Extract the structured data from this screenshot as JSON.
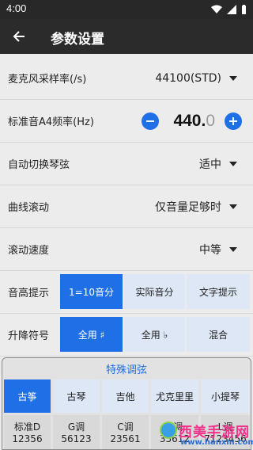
{
  "status_bar": {
    "time": "4:00"
  },
  "app_bar": {
    "title": "参数设置"
  },
  "settings": {
    "mic_sample_rate": {
      "label": "麦克风采样率(/s)",
      "value": "44100(STD)"
    },
    "a4_frequency": {
      "label": "标准音A4频率(Hz)",
      "value_int": "440.",
      "value_dec": "0"
    },
    "auto_switch": {
      "label": "自动切换琴弦",
      "value": "适中"
    },
    "curve_scroll": {
      "label": "曲线滚动",
      "value": "仅音量足够时"
    },
    "scroll_speed": {
      "label": "滚动速度",
      "value": "中等"
    },
    "pitch_hint": {
      "label": "音高提示",
      "options": [
        "1=10音分",
        "实际音分",
        "文字提示"
      ],
      "selected": 0
    },
    "accidental": {
      "label": "升降符号",
      "options": [
        "全用 ♯",
        "全用 ♭",
        "混合"
      ],
      "selected": 0
    }
  },
  "special_tuning": {
    "title": "特殊调弦",
    "instruments": [
      "古筝",
      "古琴",
      "吉他",
      "尤克里里",
      "小提琴"
    ],
    "selected": 0,
    "tunings": [
      {
        "name": "标准D",
        "notes": "12356"
      },
      {
        "name": "G调",
        "notes": "56123"
      },
      {
        "name": "C调",
        "notes": "23561"
      },
      {
        "name": "A调",
        "notes": "35612"
      },
      {
        "name": "L调",
        "notes": "7123456"
      }
    ]
  },
  "watermark": {
    "brand": "西美手游网",
    "url": "www.hanxm.com"
  },
  "colors": {
    "accent": "#1f6fe6",
    "appbar": "#2b2b2b",
    "background": "#ececec"
  }
}
